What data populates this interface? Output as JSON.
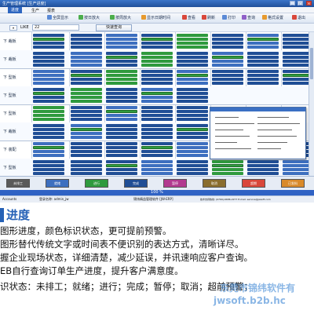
{
  "window": {
    "title": "生产管理系统 [生产进度]",
    "controls": [
      "_",
      "□",
      "×"
    ]
  },
  "menubar": {
    "tab": "进度",
    "items": [
      "生产",
      "报表"
    ]
  },
  "toolbar": {
    "buttons": [
      {
        "label": "全屏显示",
        "icon": "fullscreen-icon"
      },
      {
        "label": "按日放大",
        "icon": "zoom-in-icon"
      },
      {
        "label": "按周放大",
        "icon": "zoom-in-icon"
      },
      {
        "label": "显示日期时间",
        "icon": "calendar-icon"
      },
      {
        "label": "查看",
        "icon": "view-icon"
      },
      {
        "label": "刷新",
        "icon": "refresh-icon"
      },
      {
        "label": "打印",
        "icon": "print-icon"
      },
      {
        "label": "查询",
        "icon": "search-icon"
      },
      {
        "label": "格式设置",
        "icon": "settings-icon"
      },
      {
        "label": "退出",
        "icon": "exit-icon"
      }
    ]
  },
  "filter": {
    "label": "LIKE",
    "value": "22",
    "query_button": "快速查询"
  },
  "grid": {
    "rows": [
      {
        "label": "下 裁板"
      },
      {
        "label": "下 裁板"
      },
      {
        "label": "下 型板"
      },
      {
        "label": "下 型板"
      },
      {
        "label": "下 型板"
      },
      {
        "label": "下 裁板"
      },
      {
        "label": "下 装配"
      },
      {
        "label": "下 型板"
      }
    ]
  },
  "legend": {
    "items": [
      {
        "label": "未排工",
        "color": "#5a5a5a"
      },
      {
        "label": "就绪",
        "color": "#3d6fbf"
      },
      {
        "label": "进行",
        "color": "#2f9a3e"
      },
      {
        "label": "完成",
        "color": "#204e95"
      },
      {
        "label": "暂停",
        "color": "#b23a8f"
      },
      {
        "label": "取消",
        "color": "#8a6d2e"
      },
      {
        "label": "超期",
        "color": "#d9473a"
      },
      {
        "label": "已发料",
        "color": "#d98a2a"
      }
    ]
  },
  "progress": {
    "text": "100 %",
    "value": 100
  },
  "statusbar": {
    "left": "Accounts",
    "mid1": "登录名称: admin_jw",
    "mid2": "锦纬精益管理软件 [JW-ERP]",
    "right": "技术支持热线: (0769)-6686-2277  E-mail: service@jwsoft.com",
    "version": "Ver: 8.0.0.0(8.0)"
  },
  "description": {
    "title": "进度",
    "lines": [
      "图形进度，颜色标识状态，更可提前预警。",
      "图形替代传统文字或时间表不便识别的表达方式，清晰详尽。",
      "握企业现场状态，详细清楚，减少延误，并讯速响应客户查询。",
      "EB自行查询订单生产进度，提升客户满意度。",
      "识状态：未排工；就绪；进行；完成；暂停；取消；超前预警；"
    ]
  },
  "watermark": {
    "line1": "东莞市锦纬软件有",
    "line2": "jwsoft.b2b.hc"
  },
  "colors": {
    "accent": "#2561b6",
    "title_bar": "#1f4f9a",
    "bar_blue": "#204e95",
    "bar_green": "#2f9a3e"
  }
}
